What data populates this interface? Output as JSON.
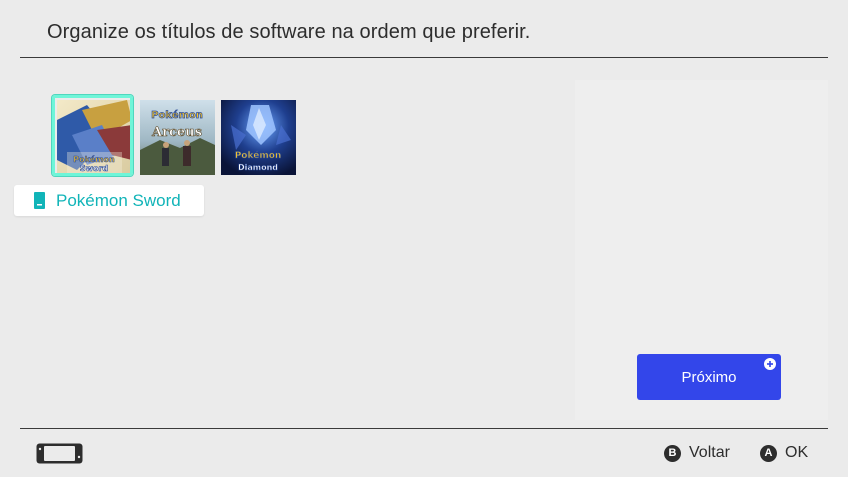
{
  "header": {
    "title": "Organize os títulos de software na ordem que preferir."
  },
  "tiles": [
    {
      "name": "Pokémon Sword",
      "logo_line1": "Pokémon",
      "logo_line2": "Sword",
      "selected": true
    },
    {
      "name": "Pokémon Legends Arceus",
      "logo_line1": "Pokémon",
      "logo_line2": "Arceus",
      "selected": false
    },
    {
      "name": "Pokémon Brilliant Diamond",
      "logo_line1": "Pokémon",
      "logo_line2": "Diamond",
      "selected": false
    }
  ],
  "tooltip": {
    "label": "Pokémon Sword",
    "icon": "game-card-icon",
    "color": "#11b4b8"
  },
  "next_button": {
    "label": "Próximo",
    "icon": "plus-icon",
    "color": "#3346ea"
  },
  "footer": {
    "console_icon": "switch-console-icon",
    "back": {
      "glyph": "B",
      "label": "Voltar"
    },
    "ok": {
      "glyph": "A",
      "label": "OK"
    }
  },
  "colors": {
    "background": "#ebebeb",
    "selection": "#6ff5d8"
  }
}
